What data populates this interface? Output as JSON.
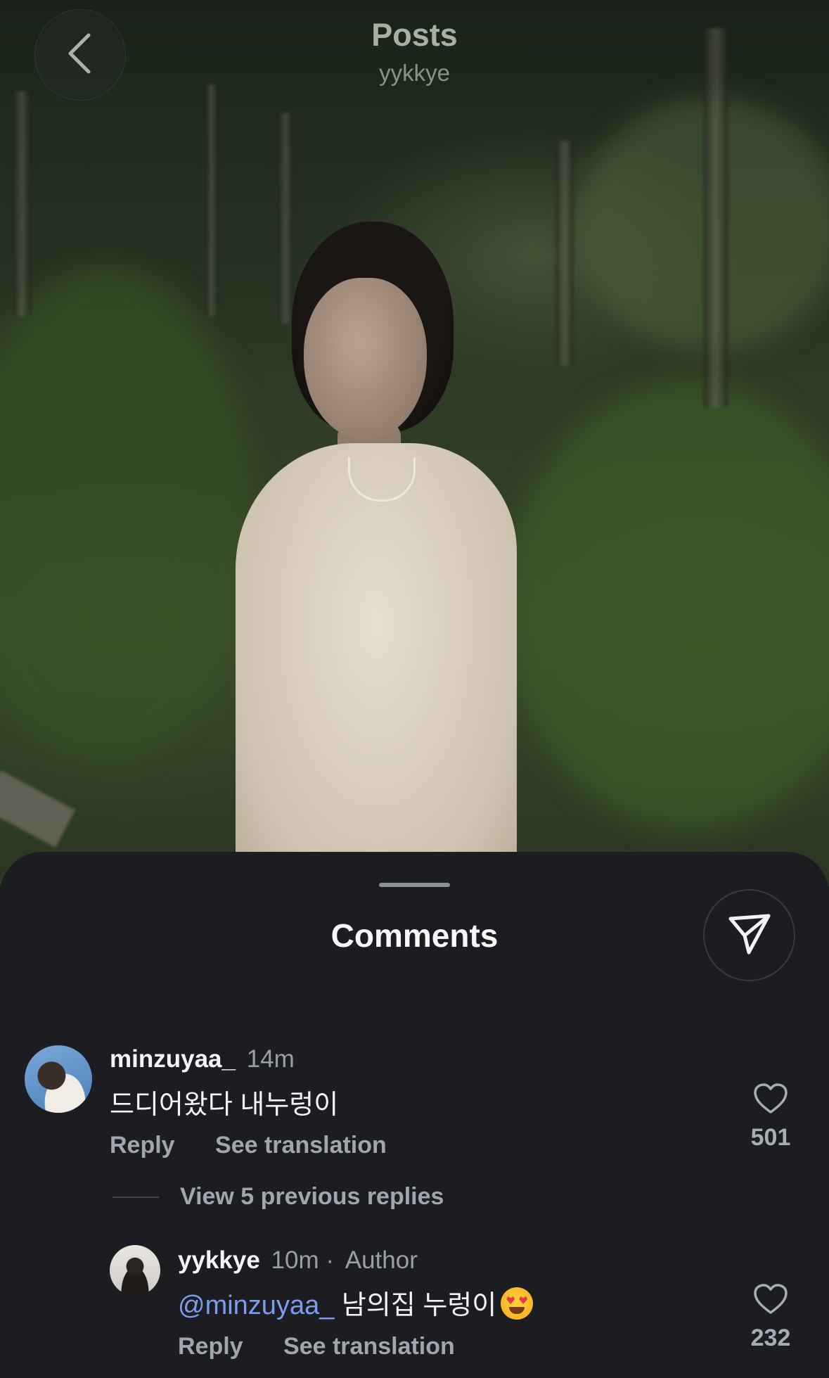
{
  "header": {
    "title": "Posts",
    "subtitle": "yykkye"
  },
  "comments_sheet": {
    "title": "Comments",
    "comments": [
      {
        "username": "minzuyaa_",
        "time": "14m",
        "text": "드디어왔다 내누렁이",
        "reply_label": "Reply",
        "translate_label": "See translation",
        "likes": "501"
      },
      {
        "username": "yykkye",
        "time": "10m",
        "separator": "·",
        "badge": "Author",
        "mention": "@minzuyaa_",
        "text": "남의집 누렁이",
        "emoji": "smiling-face-with-heart-eyes",
        "reply_label": "Reply",
        "translate_label": "See translation",
        "likes": "232"
      }
    ],
    "view_replies_label": "View 5 previous replies"
  },
  "icons": {
    "back": "chevron-left-icon",
    "share": "paper-plane-icon",
    "like": "heart-icon"
  }
}
